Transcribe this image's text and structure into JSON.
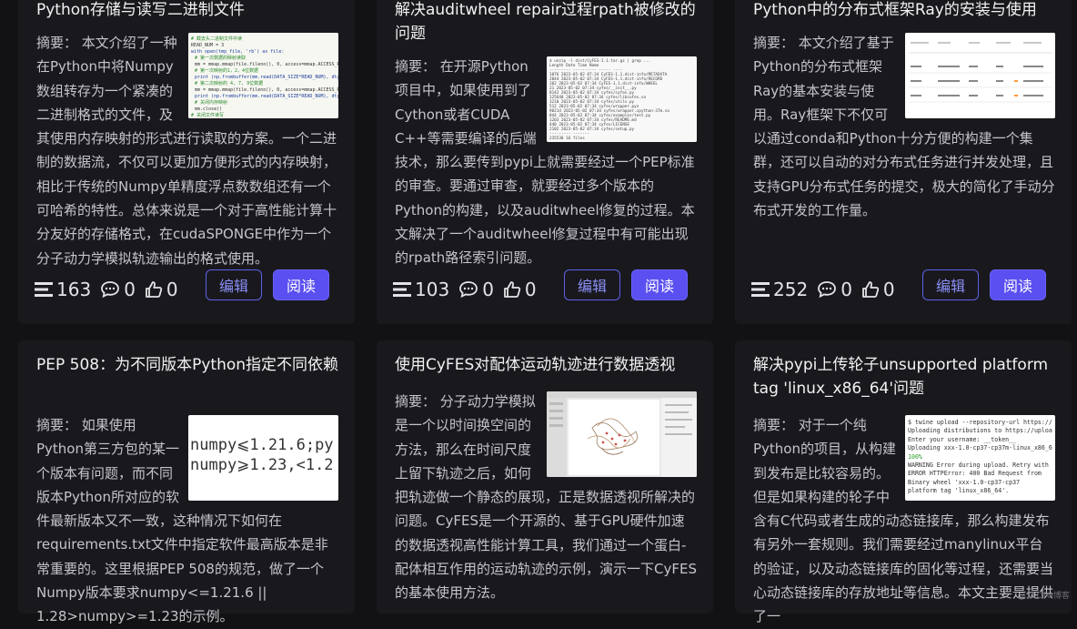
{
  "cards": [
    {
      "title": "Python存储与读写二进制文件",
      "summary_label": "摘要：",
      "summary": "本文介绍了一种在Python中将Numpy数组转存为一个紧凑的二进制格式的文件，及其使用内存映射的形式进行读取的方案。一个二进制的数据流，不仅可以更加方便形式的内存映射，相比于传统的Numpy单精度浮点数数组还有一个可哈希的特性。总体来说是一个对于高性能计算十分友好的存储格式，在cudaSPONGE中作为一个分子动力学模拟轨迹输出的格式使用。",
      "views": "163",
      "comments": "0",
      "likes": "0",
      "edit_label": "编辑",
      "read_label": "阅读",
      "thumb_icon": "code-screenshot-thumbnail"
    },
    {
      "title": "解决auditwheel repair过程rpath被修改的问题",
      "summary_label": "摘要：",
      "summary": "在开源Python项目中，如果使用到了Cython或者CUDA C++等需要编译的后端技术，那么要传到pypi上就需要经过一个PEP标准的审查。要通过审查，就要经过多个版本的Python的构建，以及auditwheel修复的过程。本文解决了一个auditwheel修复过程中有可能出现的rpath路径索引问题。",
      "views": "103",
      "comments": "0",
      "likes": "0",
      "edit_label": "编辑",
      "read_label": "阅读",
      "thumb_icon": "terminal-listing-thumbnail"
    },
    {
      "title": "Python中的分布式框架Ray的安装与使用",
      "summary_label": "摘要：",
      "summary": "本文介绍了基于Python的分布式框架Ray的基本安装与使用。Ray框架下不仅可以通过conda和Python十分方便的构建一个集群，还可以自动的对分布式任务进行并发处理，且支持GPU分布式任务的提交，极大的简化了手动分布式开发的工作量。",
      "views": "252",
      "comments": "0",
      "likes": "0",
      "edit_label": "编辑",
      "read_label": "阅读",
      "thumb_icon": "table-screenshot-thumbnail"
    },
    {
      "title": "PEP 508：为不同版本Python指定不同依赖",
      "summary_label": "摘要：",
      "summary": "如果使用Python第三方包的某一个版本有问题，而不同版本Python所对应的软件最新版本又不一致，这种情况下如何在requirements.txt文件中指定软件最高版本是非常重要的。这里根据PEP 508的规范，做了一个Numpy版本要求numpy<=1.21.6 || 1.28>numpy>=1.23的示例。",
      "thumb_icon": "version-spec-thumbnail",
      "thumb_lines": [
        "numpy⩽1.21.6;py",
        "numpy⩾1.23,<1.2"
      ]
    },
    {
      "title": "使用CyFES对配体运动轨迹进行数据透视",
      "summary_label": "摘要：",
      "summary": "分子动力学模拟是一个以时间换空间的方法，那么在时间尺度上留下轨迹之后，如何把轨迹做一个静态的展现，正是数据透视所解决的问题。CyFES是一个开源的、基于GPU硬件加速的数据透视高性能计算工具，我们通过一个蛋白-配体相互作用的运动轨迹的示例，演示一下CyFES的基本使用方法。",
      "thumb_icon": "molecule-viewer-thumbnail"
    },
    {
      "title": "解决pypi上传轮子unsupported platform tag 'linux_x86_64'问题",
      "summary_label": "摘要：",
      "summary": "对于一个纯Python的项目，从构建到发布是比较容易的。但是如果构建的轮子中含有C代码或者生成的动态链接库，那么构建发布有另外一套规则。我们需要经过manylinux平台的验证，以及动态链接库的固化等过程，还需要当心动态链接库的存放地址等信息。本文主要是提供了一",
      "thumb_icon": "twine-terminal-thumbnail",
      "thumb_lines": [
        "$ twine upload --repository-url https://",
        "Uploading distributions to https://uploa",
        "Enter your username: __token__",
        "Uploading xxx-1.0-cp37-cp37m-linux_x86_6",
        "100%",
        "WARNING  Error during upload. Retry with",
        "ERROR    HTTPError: 400 Bad Request from",
        "         Binary wheel 'xxx-1.0-cp37-cp37",
        "         platform tag 'linux_x86_64'."
      ]
    }
  ],
  "watermark": "@51CTO博客",
  "colors": {
    "accent": "#5a4ff0",
    "background": "#121214",
    "card": "#19191d"
  }
}
